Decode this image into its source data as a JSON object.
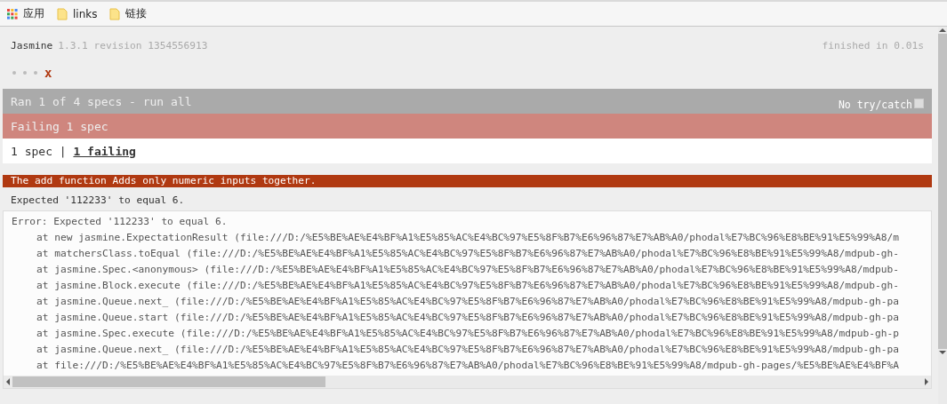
{
  "bookmarks_bar": {
    "items": [
      {
        "kind": "apps",
        "label": "应用"
      },
      {
        "kind": "folder",
        "label": "links"
      },
      {
        "kind": "folder",
        "label": "链接"
      }
    ]
  },
  "banner": {
    "title": "Jasmine",
    "version": "1.3.1 revision 1354556913",
    "duration": "finished in 0.01s"
  },
  "symbol_summary": [
    {
      "kind": "passed"
    },
    {
      "kind": "passed"
    },
    {
      "kind": "passed"
    },
    {
      "kind": "failed",
      "label": "x"
    }
  ],
  "alert_bars": [
    {
      "kind": "skipped",
      "text": "Ran 1 of 4 specs - ",
      "link": "run all",
      "option": {
        "label": "No try/catch",
        "checked": false
      }
    },
    {
      "kind": "failed",
      "text": "Failing 1 spec"
    }
  ],
  "menu": {
    "text": "1 spec | ",
    "link": "1 failing"
  },
  "failure": {
    "description": "The add function Adds only numeric inputs together.",
    "message": "Expected '112233' to equal 6.",
    "stack_header": "Error: Expected '112233' to equal 6.",
    "stack": [
      "at new jasmine.ExpectationResult (file:///D:/%E5%BE%AE%E4%BF%A1%E5%85%AC%E4%BC%97%E5%8F%B7%E6%96%87%E7%AB%A0/phodal%E7%BC%96%E8%BE%91%E5%99%A8/m",
      "at matchersClass.toEqual (file:///D:/%E5%BE%AE%E4%BF%A1%E5%85%AC%E4%BC%97%E5%8F%B7%E6%96%87%E7%AB%A0/phodal%E7%BC%96%E8%BE%91%E5%99%A8/mdpub-gh-",
      "at jasmine.Spec.<anonymous> (file:///D:/%E5%BE%AE%E4%BF%A1%E5%85%AC%E4%BC%97%E5%8F%B7%E6%96%87%E7%AB%A0/phodal%E7%BC%96%E8%BE%91%E5%99%A8/mdpub-",
      "at jasmine.Block.execute (file:///D:/%E5%BE%AE%E4%BF%A1%E5%85%AC%E4%BC%97%E5%8F%B7%E6%96%87%E7%AB%A0/phodal%E7%BC%96%E8%BE%91%E5%99%A8/mdpub-gh-",
      "at jasmine.Queue.next_ (file:///D:/%E5%BE%AE%E4%BF%A1%E5%85%AC%E4%BC%97%E5%8F%B7%E6%96%87%E7%AB%A0/phodal%E7%BC%96%E8%BE%91%E5%99%A8/mdpub-gh-pa",
      "at jasmine.Queue.start (file:///D:/%E5%BE%AE%E4%BF%A1%E5%85%AC%E4%BC%97%E5%8F%B7%E6%96%87%E7%AB%A0/phodal%E7%BC%96%E8%BE%91%E5%99%A8/mdpub-gh-pa",
      "at jasmine.Spec.execute (file:///D:/%E5%BE%AE%E4%BF%A1%E5%85%AC%E4%BC%97%E5%8F%B7%E6%96%87%E7%AB%A0/phodal%E7%BC%96%E8%BE%91%E5%99%A8/mdpub-gh-p",
      "at jasmine.Queue.next_ (file:///D:/%E5%BE%AE%E4%BF%A1%E5%85%AC%E4%BC%97%E5%8F%B7%E6%96%87%E7%AB%A0/phodal%E7%BC%96%E8%BE%91%E5%99%A8/mdpub-gh-pa",
      "at file:///D:/%E5%BE%AE%E4%BF%A1%E5%85%AC%E4%BC%97%E5%8F%B7%E6%96%87%E7%AB%A0/phodal%E7%BC%96%E8%BE%91%E5%99%A8/mdpub-gh-pages/%E5%BE%AE%E4%BF%A"
    ]
  }
}
